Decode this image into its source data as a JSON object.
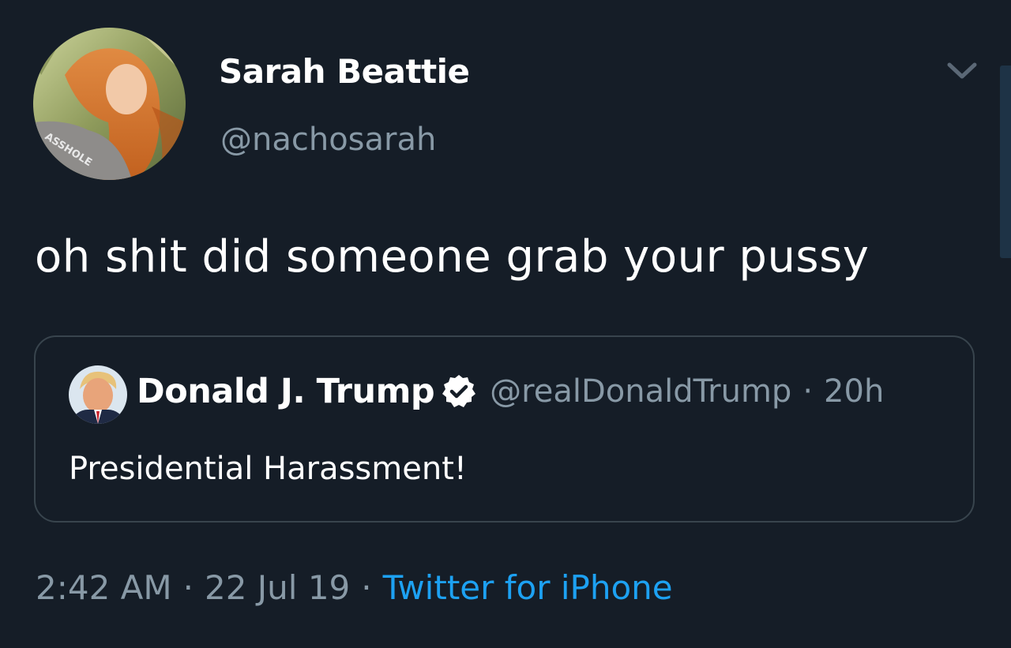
{
  "author": {
    "display_name": "Sarah Beattie",
    "handle": "@nachosarah",
    "avatar_shirt_text": "ASSHOLE"
  },
  "tweet": {
    "text": "oh shit did someone grab your pussy"
  },
  "quoted_tweet": {
    "display_name": "Donald J. Trump",
    "verified": true,
    "handle": "@realDonaldTrump",
    "separator": "·",
    "time": "20h",
    "text": "Presidential Harassment!"
  },
  "meta": {
    "time": "2:42 AM",
    "separator": "·",
    "date": "22 Jul 19",
    "source": "Twitter for iPhone"
  },
  "icons": {
    "caret": "chevron-down-icon",
    "verified": "verified-badge-icon"
  },
  "colors": {
    "background": "#151d27",
    "secondary_text": "#8899a6",
    "link": "#1da1f2",
    "border": "#38444d"
  }
}
